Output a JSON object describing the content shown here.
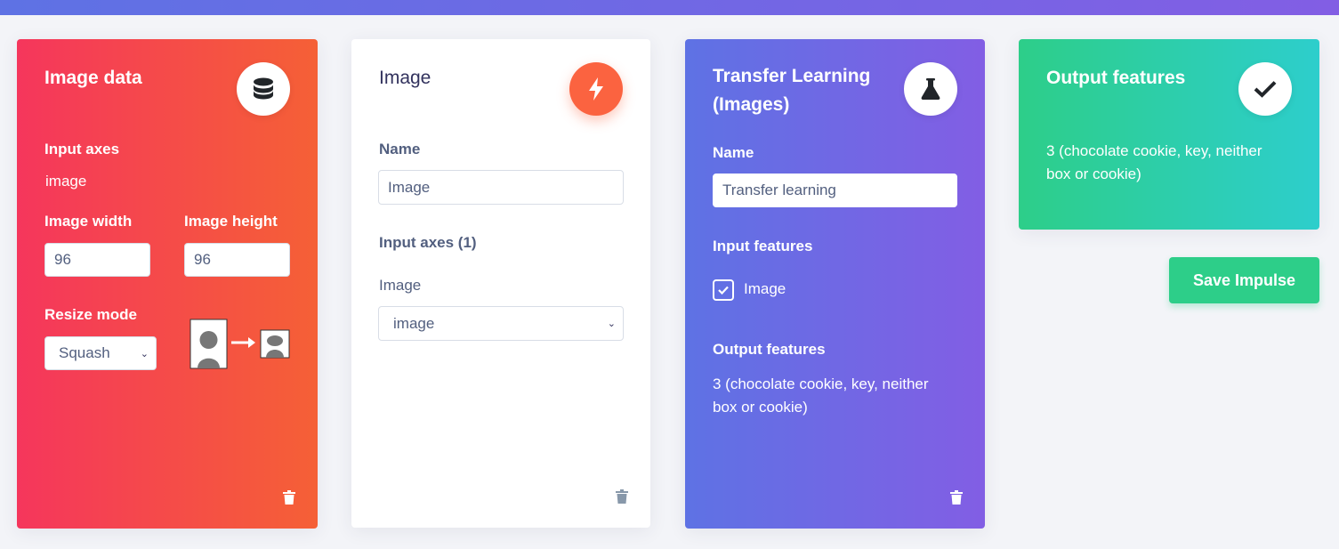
{
  "image_data_block": {
    "title": "Image data",
    "input_axes_label": "Input axes",
    "input_axes_value": "image",
    "width_label": "Image width",
    "width_value": "96",
    "height_label": "Image height",
    "height_value": "96",
    "resize_label": "Resize mode",
    "resize_value": "Squash",
    "icon": "database-icon"
  },
  "processing_block": {
    "title": "Image",
    "name_label": "Name",
    "name_value": "Image",
    "input_axes_label": "Input axes (1)",
    "axis_label": "Image",
    "axis_value": "image",
    "icon": "bolt-icon"
  },
  "learning_block": {
    "title_line1": "Transfer Learning",
    "title_line2": "(Images)",
    "name_label": "Name",
    "name_value": "Transfer learning",
    "input_features_label": "Input features",
    "feature_checkbox_label": "Image",
    "output_features_label": "Output features",
    "output_line1": "3 (chocolate cookie, key, neither",
    "output_line2": "box or cookie)",
    "icon": "flask-icon"
  },
  "output_block": {
    "title": "Output features",
    "line1": "3 (chocolate cookie, key, neither",
    "line2": "box or cookie)",
    "icon": "check-icon"
  },
  "save_button": "Save Impulse",
  "colors": {
    "red": "#f5365c",
    "orange": "#fb6340",
    "indigo": "#5e72e4",
    "purple": "#825ee4",
    "green": "#2dce89",
    "teal": "#2dcecc"
  }
}
